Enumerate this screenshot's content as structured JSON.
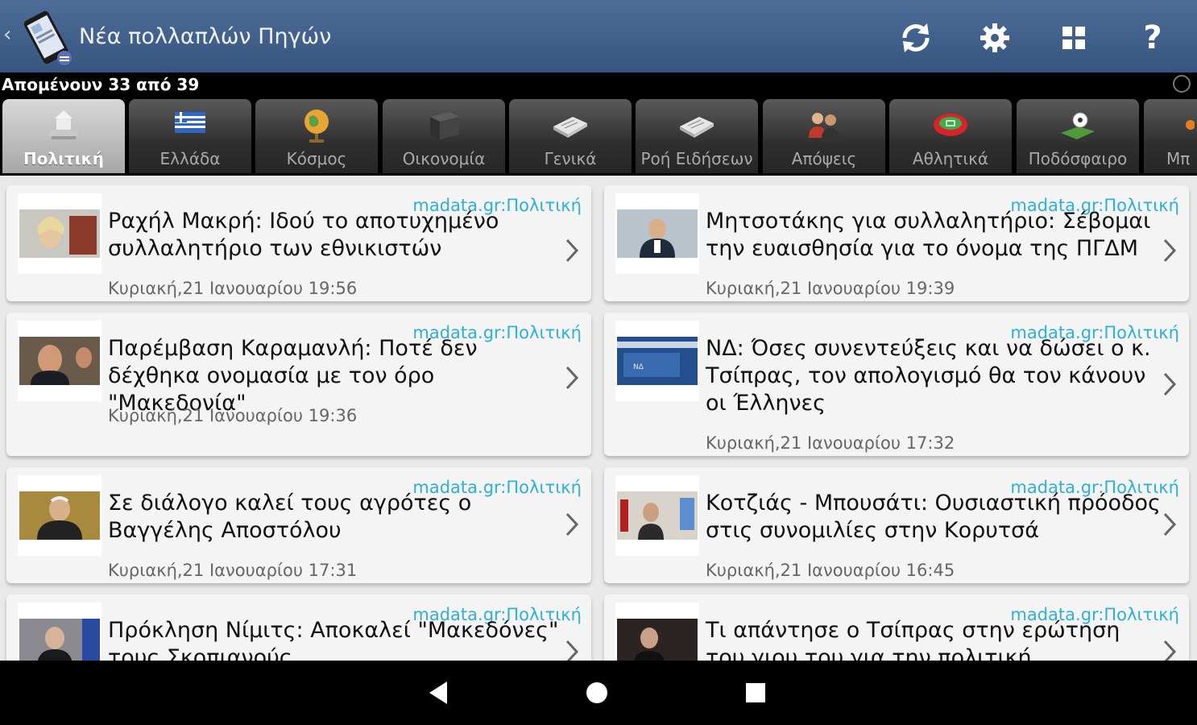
{
  "appbar": {
    "title": "Νέα πολλαπλών Πηγών",
    "icons": [
      "back-chevron-icon",
      "app-logo-icon",
      "refresh-icon",
      "gear-icon",
      "grid-icon",
      "help-icon"
    ],
    "help_label": "?"
  },
  "status": {
    "remaining": "Απομένουν 33 από 39"
  },
  "tabs": [
    {
      "label": "Πολιτική",
      "icon": "parliament-icon",
      "active": true
    },
    {
      "label": "Ελλάδα",
      "icon": "greek-flag-icon",
      "active": false
    },
    {
      "label": "Κόσμος",
      "icon": "globe-icon",
      "active": false
    },
    {
      "label": "Οικονομία",
      "icon": "safe-icon",
      "active": false
    },
    {
      "label": "Γενικά",
      "icon": "newspaper-icon",
      "active": false
    },
    {
      "label": "Ροή Ειδήσεων",
      "icon": "newspaper-icon",
      "active": false
    },
    {
      "label": "Απόψεις",
      "icon": "people-icon",
      "active": false
    },
    {
      "label": "Αθλητικά",
      "icon": "stadium-icon",
      "active": false
    },
    {
      "label": "Ποδόσφαιρο",
      "icon": "football-icon",
      "active": false
    },
    {
      "label": "Μπ",
      "icon": "basketball-icon",
      "active": false
    }
  ],
  "articles": [
    {
      "source": "madata.gr:Πολιτική",
      "title": "Ραχήλ Μακρή: Ιδού το αποτυχημένο συλλαλητήριο των εθνικιστών",
      "date": "Κυριακή,21 Ιανουαρίου 19:56"
    },
    {
      "source": "madata.gr:Πολιτική",
      "title": "Μητσοτάκης για συλλαλητήριο: Σέβομαι την ευαισθησία για το όνομα της ΠΓΔΜ",
      "date": "Κυριακή,21 Ιανουαρίου 19:39"
    },
    {
      "source": "madata.gr:Πολιτική",
      "title": "Παρέμβαση Καραμανλή: Ποτέ δεν δέχθηκα ονομασία με τον όρο \"Μακεδονία\"",
      "date": "Κυριακή,21 Ιανουαρίου 19:36"
    },
    {
      "source": "madata.gr:Πολιτική",
      "title": "ΝΔ: Όσες συνεντεύξεις και να δώσει ο κ. Τσίπρας, τον απολογισμό θα τον κάνουν οι Έλληνες",
      "date": "Κυριακή,21 Ιανουαρίου 17:32"
    },
    {
      "source": "madata.gr:Πολιτική",
      "title": "Σε διάλογο καλεί τους αγρότες ο Βαγγέλης Αποστόλου",
      "date": "Κυριακή,21 Ιανουαρίου 17:31"
    },
    {
      "source": "madata.gr:Πολιτική",
      "title": "Κοτζιάς - Μπουσάτι: Ουσιαστική πρόοδος στις συνομιλίες στην Κορυτσά",
      "date": "Κυριακή,21 Ιανουαρίου 16:45"
    },
    {
      "source": "madata.gr:Πολιτική",
      "title": "Πρόκληση Νίμιτς: Αποκαλεί \"Μακεδόνες\" τους Σκοπιανούς",
      "date": ""
    },
    {
      "source": "madata.gr:Πολιτική",
      "title": "Τι απάντησε ο Τσίπρας στην ερώτηση του γιου του για την πολιτική",
      "date": ""
    }
  ],
  "navbar": {
    "icons": [
      "nav-back-icon",
      "nav-home-icon",
      "nav-recents-icon"
    ]
  }
}
